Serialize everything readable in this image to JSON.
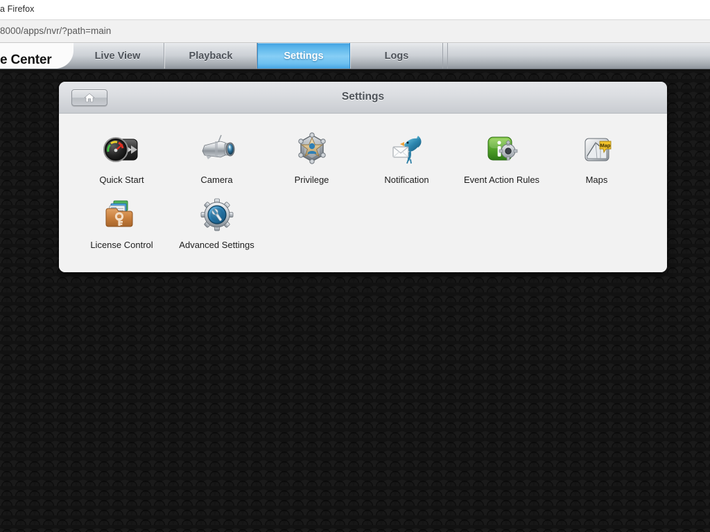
{
  "browser": {
    "window_title": "a Firefox",
    "url": "8000/apps/nvr/?path=main"
  },
  "nav": {
    "brand": "e Center",
    "tabs": [
      {
        "label": "Live View",
        "active": false
      },
      {
        "label": "Playback",
        "active": false
      },
      {
        "label": "Settings",
        "active": true
      },
      {
        "label": "Logs",
        "active": false
      }
    ],
    "active_tab_color": "#74c4f1"
  },
  "panel": {
    "title": "Settings",
    "home_button_icon": "home-icon",
    "items": [
      {
        "label": "Quick Start",
        "icon": "gauge-fastforward-icon"
      },
      {
        "label": "Camera",
        "icon": "security-camera-icon"
      },
      {
        "label": "Privilege",
        "icon": "sheriff-badge-user-icon"
      },
      {
        "label": "Notification",
        "icon": "bird-envelope-icon"
      },
      {
        "label": "Event Action Rules",
        "icon": "green-info-gear-icon"
      },
      {
        "label": "Maps",
        "icon": "folded-map-icon"
      },
      {
        "label": "License Control",
        "icon": "folder-key-cards-icon"
      },
      {
        "label": "Advanced Settings",
        "icon": "gear-wrench-icon"
      }
    ]
  },
  "theme": {
    "desktop_background": "#121212",
    "panel_background": "#f2f2f2",
    "accent": "#4ea8e8"
  }
}
